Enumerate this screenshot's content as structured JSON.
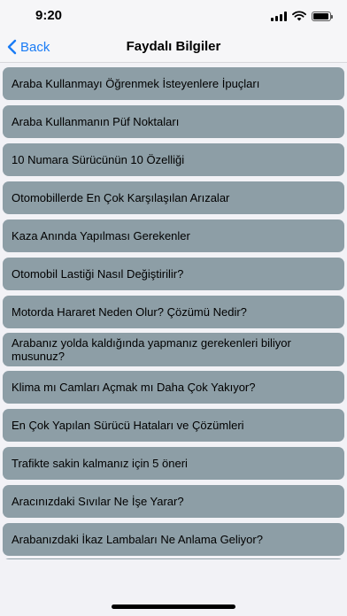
{
  "status_bar": {
    "time": "9:20"
  },
  "nav": {
    "back_label": "Back",
    "title": "Faydalı Bilgiler"
  },
  "list": {
    "items": [
      "Araba Kullanmayı Öğrenmek İsteyenlere İpuçları",
      "Araba Kullanmanın Püf Noktaları",
      "10 Numara Sürücünün 10 Özelliği",
      "Otomobillerde En Çok Karşılaşılan Arızalar",
      "Kaza Anında Yapılması Gerekenler",
      "Otomobil Lastiği Nasıl Değiştirilir?",
      "Motorda Hararet Neden Olur? Çözümü Nedir?",
      "Arabanız yolda kaldığında yapmanız gerekenleri biliyor musunuz?",
      "Klima mı Camları Açmak mı Daha Çok Yakıyor?",
      "En Çok Yapılan Sürücü Hataları ve Çözümleri",
      "Trafikte sakin kalmanız için 5 öneri",
      "Aracınızdaki Sıvılar Ne İşe Yarar?",
      "Arabanızdaki İkaz Lambaları Ne Anlama Geliyor?",
      ""
    ]
  },
  "colors": {
    "accent": "#1a7cf5",
    "item_background": "#8d9ea6",
    "page_background": "#f2f2f6"
  }
}
